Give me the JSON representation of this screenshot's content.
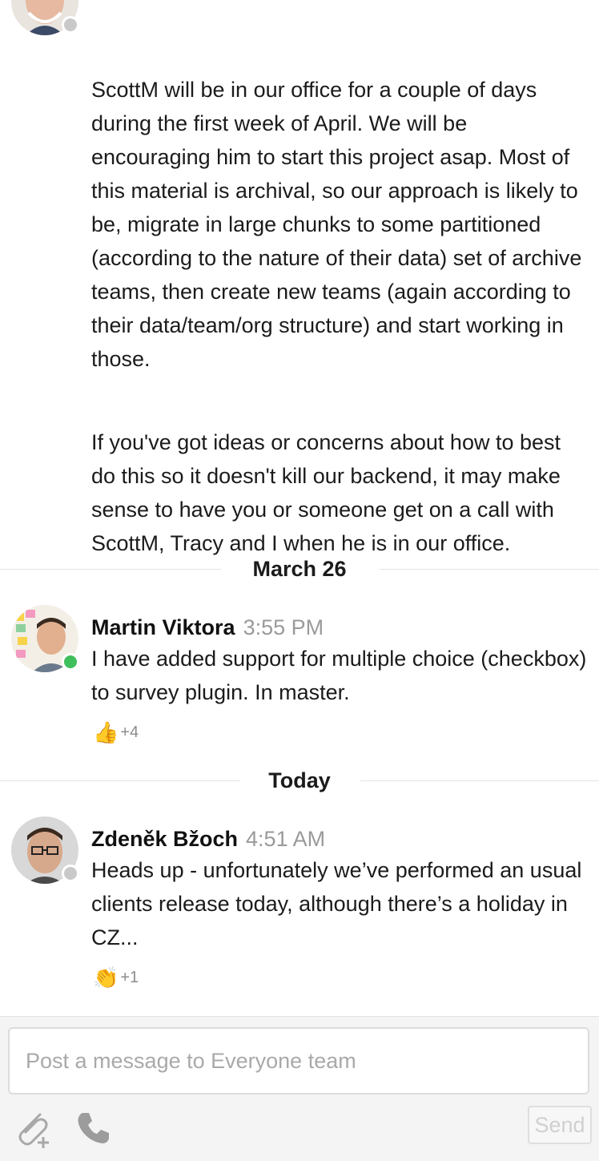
{
  "messages": [
    {
      "paragraphs": [
        "ScottM will be in our office for a couple of days during the first week of April. We will be encouraging him to start this project asap. Most of this material is archival, so our approach is likely to be, migrate in large chunks to some partitioned (according to the nature of their data) set of archive teams, then create new teams (again according to their data/team/org structure) and start working in those.",
        "If you've got ideas or concerns about how to best do this so it doesn't kill our backend, it may make sense to have you or someone get on a call with ScottM, Tracy and I when he is in our office."
      ]
    },
    {
      "date_separator": "March 26",
      "author": "Martin Viktora",
      "time": "3:55 PM",
      "text": "I have added support for multiple choice (checkbox) to survey plugin. In master.",
      "reaction": {
        "emoji": "👍",
        "count": "+4"
      },
      "status": "online"
    },
    {
      "date_separator": "Today",
      "author": "Zdeněk Bžoch",
      "time": "4:51 AM",
      "text": "Heads up - unfortunately we’ve performed an usual clients release today, although there’s a holiday in CZ...",
      "reaction": {
        "emoji": "👏",
        "count": "+1"
      },
      "status": "away"
    }
  ],
  "composer": {
    "placeholder": "Post a message to Everyone team",
    "send_label": "Send",
    "attach_icon": "paperclip-plus-icon",
    "call_icon": "phone-icon"
  },
  "colors": {
    "online": "#3fbf5b",
    "away": "#c9c9c9",
    "timestamp": "#9a9a9a"
  }
}
